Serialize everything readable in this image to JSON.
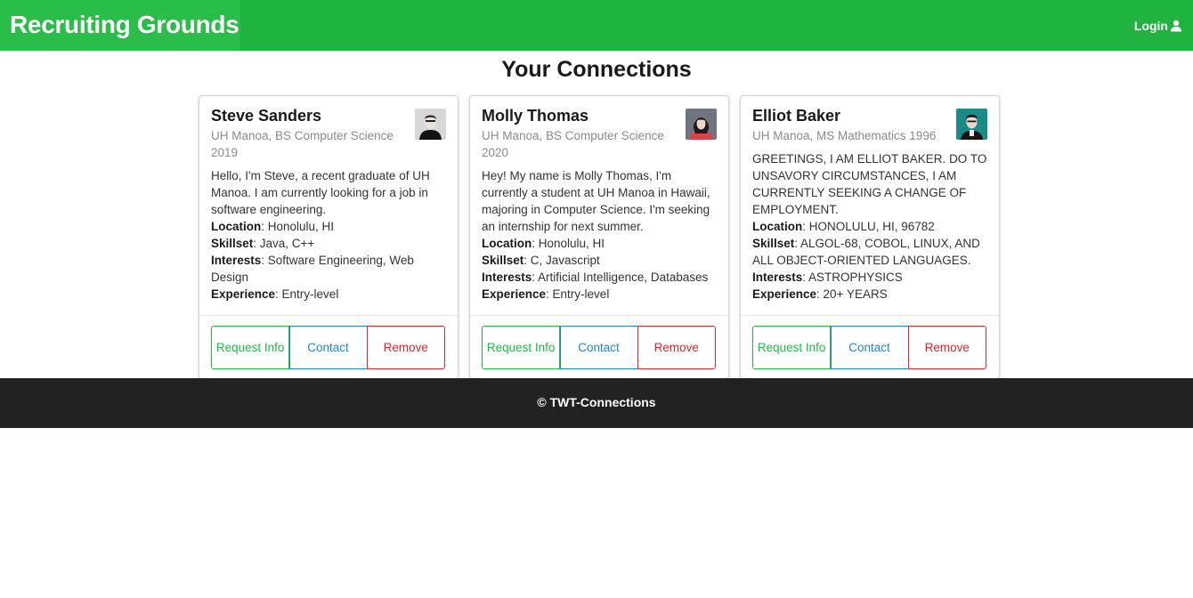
{
  "navbar": {
    "brand": "Recruiting Grounds",
    "login_label": "Login",
    "login_icon": "user-icon",
    "color": "#21b33f"
  },
  "page_title": "Your Connections",
  "cards": [
    {
      "name": "Steve Sanders",
      "meta": "UH Manoa, BS Computer Science 2019",
      "description": "Hello, I'm Steve, a recent graduate of UH Manoa. I am currently looking for a job in software engineering.",
      "location_label": "Location",
      "location": ": Honolulu, HI",
      "skillset_label": "Skillset",
      "skillset": ": Java, C++",
      "interests_label": "Interests",
      "interests": ": Software Engineering, Web Design",
      "experience_label": "Experience",
      "experience": ": Entry-level",
      "buttons": {
        "request": "Request Info",
        "contact": "Contact",
        "remove": "Remove"
      }
    },
    {
      "name": "Molly Thomas",
      "meta": "UH Manoa, BS Computer Science 2020",
      "description": "Hey! My name is Molly Thomas, I'm currently a student at UH Manoa in Hawaii, majoring in Computer Science. I'm seeking an internship for next summer.",
      "location_label": "Location",
      "location": ": Honolulu, HI",
      "skillset_label": "Skillset",
      "skillset": ": C, Javascript",
      "interests_label": "Interests",
      "interests": ": Artificial Intelligence, Databases",
      "experience_label": "Experience",
      "experience": ": Entry-level",
      "buttons": {
        "request": "Request Info",
        "contact": "Contact",
        "remove": "Remove"
      }
    },
    {
      "name": "Elliot Baker",
      "meta": "UH Manoa, MS Mathematics 1996",
      "description": "GREETINGS, I AM ELLIOT BAKER. DO TO UNSAVORY CIRCUMSTANCES, I AM CURRENTLY SEEKING A CHANGE OF EMPLOYMENT.",
      "location_label": "Location",
      "location": ": HONOLULU, HI, 96782",
      "skillset_label": "Skillset",
      "skillset": ": ALGOL-68, COBOL, LINUX, AND ALL OBJECT-ORIENTED LANGUAGES.",
      "interests_label": "Interests",
      "interests": ": ASTROPHYSICS",
      "experience_label": "Experience",
      "experience": ": 20+ YEARS",
      "buttons": {
        "request": "Request Info",
        "contact": "Contact",
        "remove": "Remove"
      }
    }
  ],
  "footer": {
    "text": "© TWT-Connections"
  }
}
